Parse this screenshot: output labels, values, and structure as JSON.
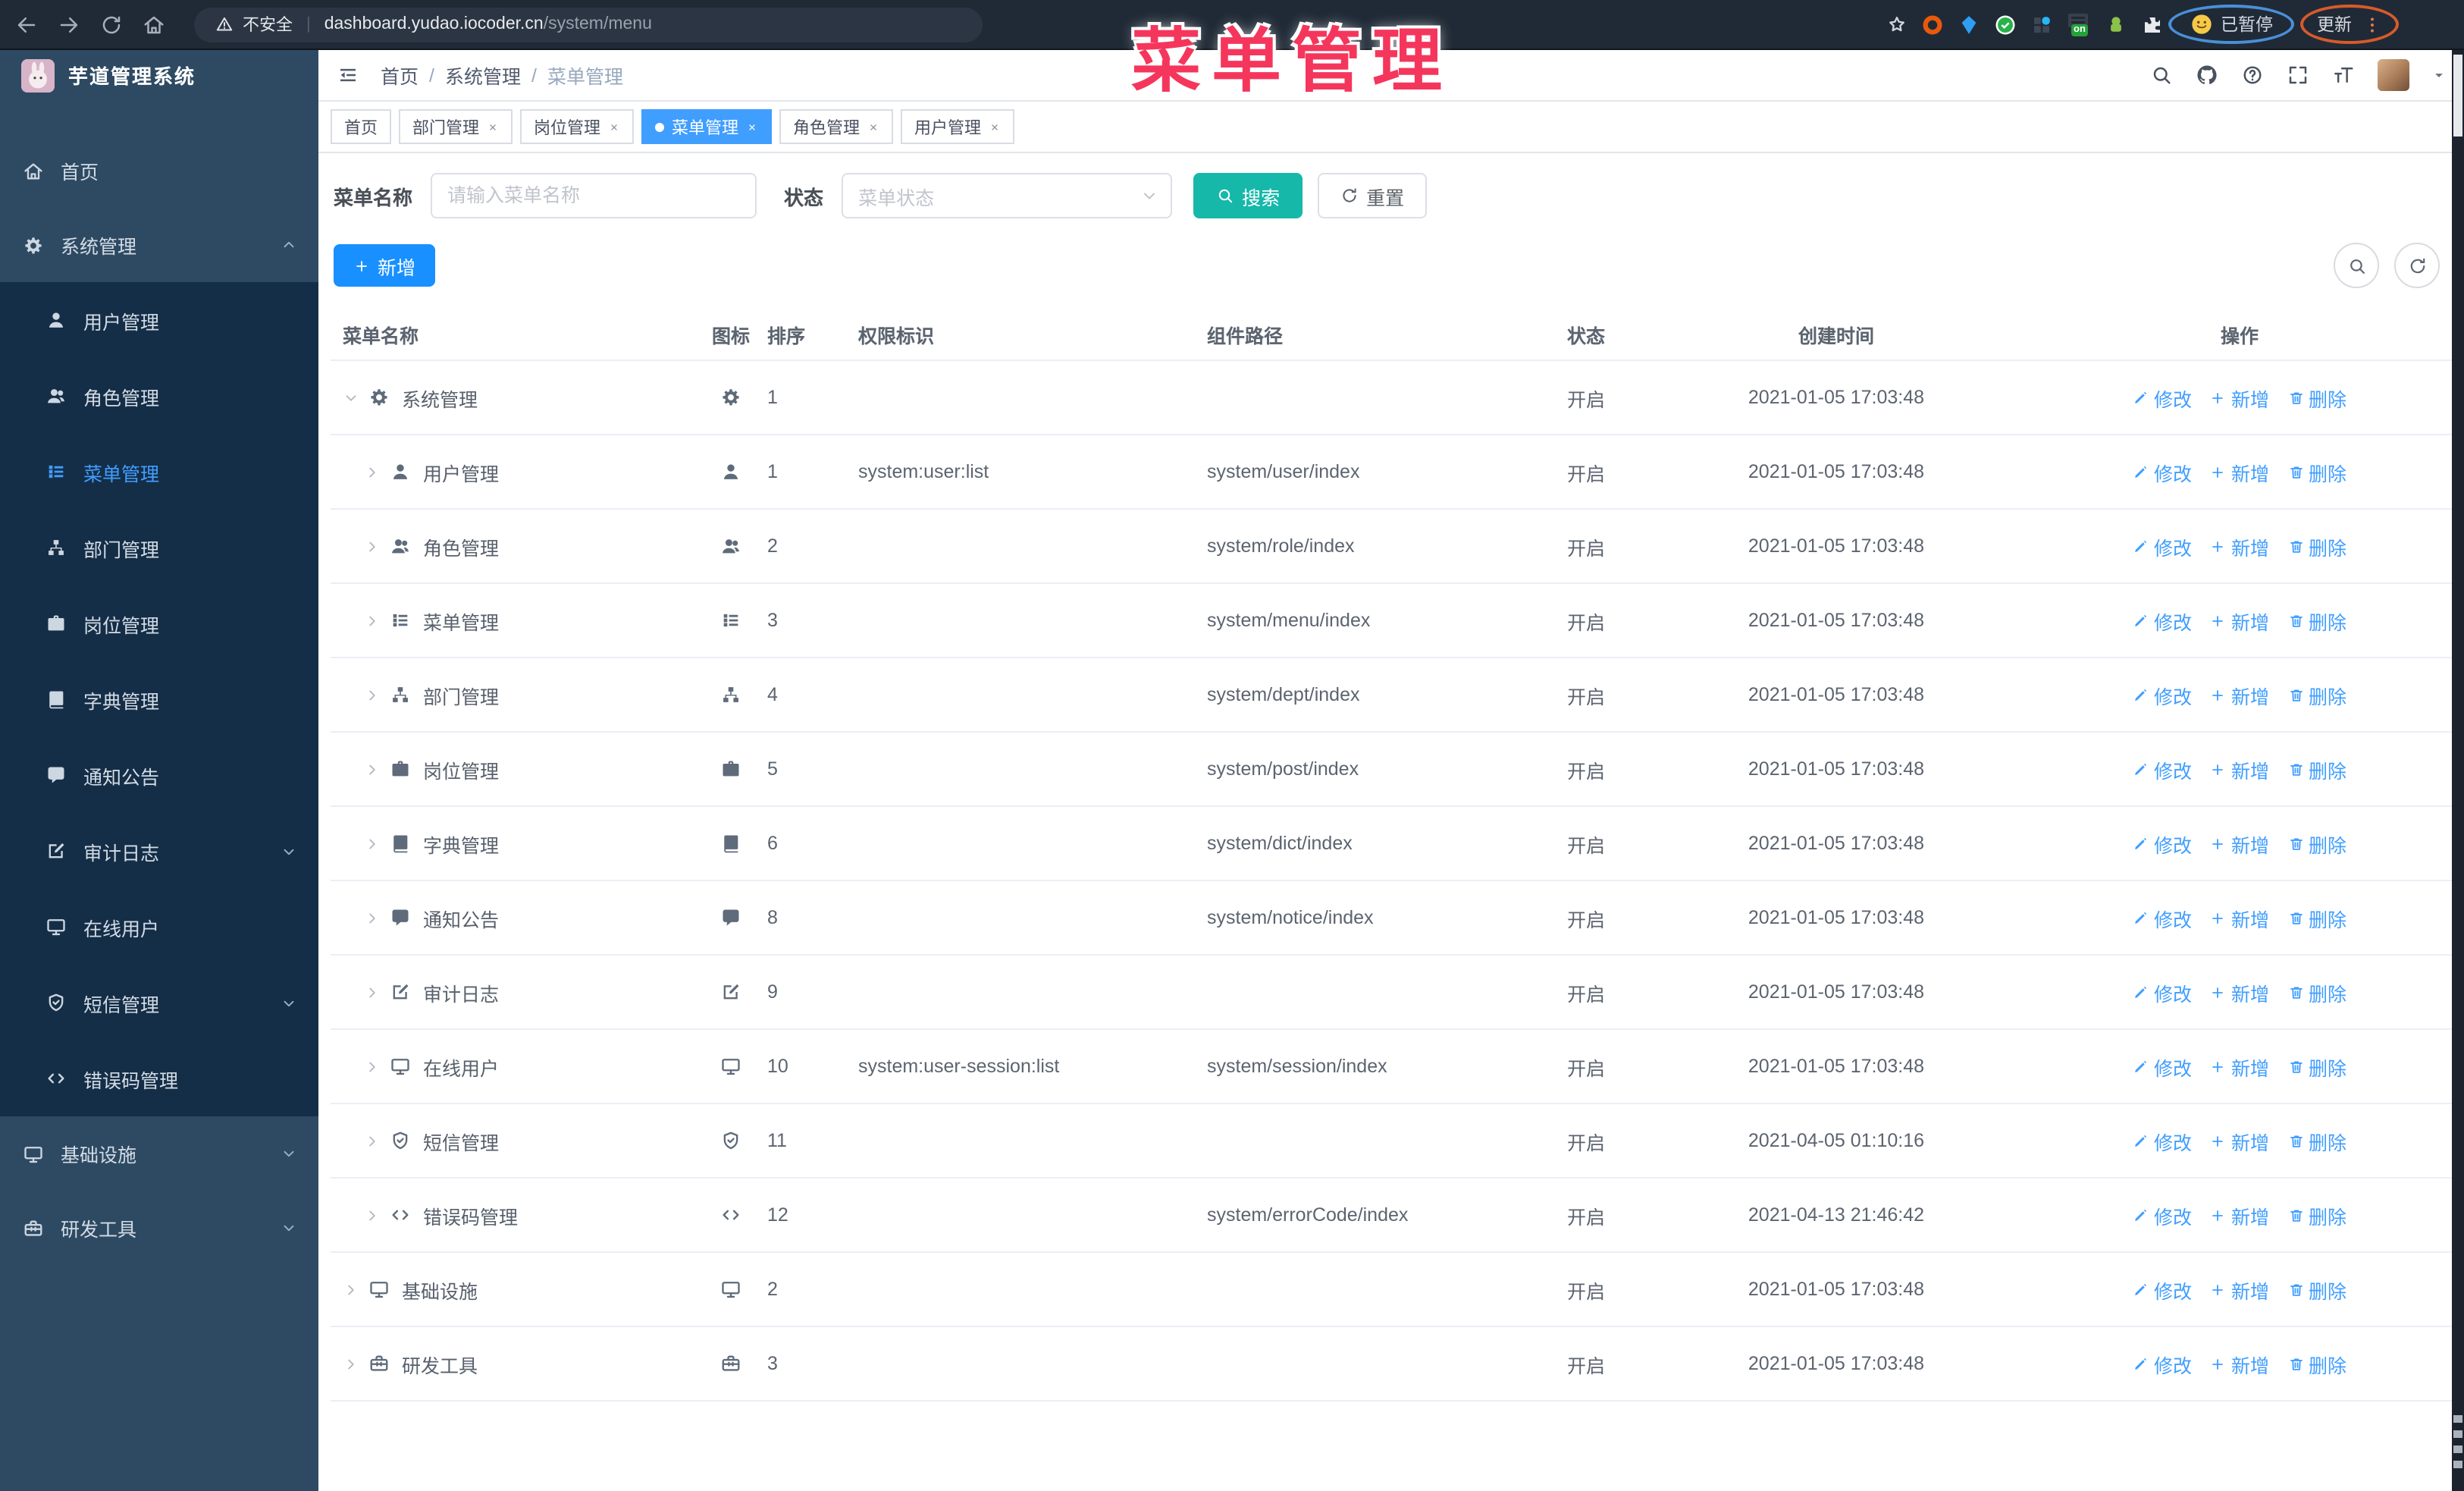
{
  "browser": {
    "security_label": "不安全",
    "url_host": "dashboard.yudao.iocoder.cn",
    "url_path": "/system/menu",
    "extensions": [
      {
        "name": "orange-ring"
      },
      {
        "name": "blue-gem"
      },
      {
        "name": "green-check"
      },
      {
        "name": "grid-blue-dot"
      },
      {
        "name": "on-badge",
        "label": "on"
      },
      {
        "name": "green-android"
      },
      {
        "name": "puzzle"
      }
    ],
    "profile_chip": {
      "label": "已暂停"
    },
    "update_label": "更新"
  },
  "annotation": {
    "text": "菜单管理",
    "color": "#f5365c"
  },
  "app": {
    "title": "芋道管理系统"
  },
  "breadcrumb": {
    "items": [
      "首页",
      "系统管理",
      "菜单管理"
    ]
  },
  "header_tabs": [
    {
      "label": "首页",
      "active": false,
      "closable": false
    },
    {
      "label": "部门管理",
      "active": false,
      "closable": true
    },
    {
      "label": "岗位管理",
      "active": false,
      "closable": true
    },
    {
      "label": "菜单管理",
      "active": true,
      "closable": true
    },
    {
      "label": "角色管理",
      "active": false,
      "closable": true
    },
    {
      "label": "用户管理",
      "active": false,
      "closable": true
    }
  ],
  "sidebar": {
    "items": [
      {
        "label": "首页",
        "icon": "home",
        "level": 0
      },
      {
        "label": "系统管理",
        "icon": "gear",
        "level": 0,
        "chevron": "up"
      },
      {
        "label": "用户管理",
        "icon": "user",
        "level": 1
      },
      {
        "label": "角色管理",
        "icon": "users",
        "level": 1
      },
      {
        "label": "菜单管理",
        "icon": "menu-list",
        "level": 1,
        "active": true
      },
      {
        "label": "部门管理",
        "icon": "org-tree",
        "level": 1
      },
      {
        "label": "岗位管理",
        "icon": "briefcase",
        "level": 1
      },
      {
        "label": "字典管理",
        "icon": "book",
        "level": 1
      },
      {
        "label": "通知公告",
        "icon": "message",
        "level": 1
      },
      {
        "label": "审计日志",
        "icon": "edit-square",
        "level": 1,
        "chevron": "down"
      },
      {
        "label": "在线用户",
        "icon": "monitor",
        "level": 1
      },
      {
        "label": "短信管理",
        "icon": "shield-check",
        "level": 1,
        "chevron": "down"
      },
      {
        "label": "错误码管理",
        "icon": "code",
        "level": 1
      },
      {
        "label": "基础设施",
        "icon": "monitor",
        "level": 0,
        "chevron": "down"
      },
      {
        "label": "研发工具",
        "icon": "toolbox",
        "level": 0,
        "chevron": "down"
      }
    ]
  },
  "filters": {
    "name_label": "菜单名称",
    "name_placeholder": "请输入菜单名称",
    "status_label": "状态",
    "status_placeholder": "菜单状态",
    "search_label": "搜索",
    "reset_label": "重置"
  },
  "toolbar": {
    "add_label": "新增"
  },
  "table": {
    "columns": [
      "菜单名称",
      "图标",
      "排序",
      "权限标识",
      "组件路径",
      "状态",
      "创建时间",
      "操作"
    ],
    "row_actions": [
      "修改",
      "新增",
      "删除"
    ],
    "rows": [
      {
        "name": "系统管理",
        "icon": "gear",
        "sort": "1",
        "perm": "",
        "path": "",
        "status": "开启",
        "time": "2021-01-05 17:03:48",
        "level": 0,
        "expanded": true
      },
      {
        "name": "用户管理",
        "icon": "user",
        "sort": "1",
        "perm": "system:user:list",
        "path": "system/user/index",
        "status": "开启",
        "time": "2021-01-05 17:03:48",
        "level": 1
      },
      {
        "name": "角色管理",
        "icon": "users",
        "sort": "2",
        "perm": "",
        "path": "system/role/index",
        "status": "开启",
        "time": "2021-01-05 17:03:48",
        "level": 1
      },
      {
        "name": "菜单管理",
        "icon": "menu-list",
        "sort": "3",
        "perm": "",
        "path": "system/menu/index",
        "status": "开启",
        "time": "2021-01-05 17:03:48",
        "level": 1
      },
      {
        "name": "部门管理",
        "icon": "org-tree",
        "sort": "4",
        "perm": "",
        "path": "system/dept/index",
        "status": "开启",
        "time": "2021-01-05 17:03:48",
        "level": 1
      },
      {
        "name": "岗位管理",
        "icon": "briefcase",
        "sort": "5",
        "perm": "",
        "path": "system/post/index",
        "status": "开启",
        "time": "2021-01-05 17:03:48",
        "level": 1
      },
      {
        "name": "字典管理",
        "icon": "book",
        "sort": "6",
        "perm": "",
        "path": "system/dict/index",
        "status": "开启",
        "time": "2021-01-05 17:03:48",
        "level": 1
      },
      {
        "name": "通知公告",
        "icon": "message",
        "sort": "8",
        "perm": "",
        "path": "system/notice/index",
        "status": "开启",
        "time": "2021-01-05 17:03:48",
        "level": 1
      },
      {
        "name": "审计日志",
        "icon": "edit-square",
        "sort": "9",
        "perm": "",
        "path": "",
        "status": "开启",
        "time": "2021-01-05 17:03:48",
        "level": 1
      },
      {
        "name": "在线用户",
        "icon": "monitor",
        "sort": "10",
        "perm": "system:user-session:list",
        "path": "system/session/index",
        "status": "开启",
        "time": "2021-01-05 17:03:48",
        "level": 1
      },
      {
        "name": "短信管理",
        "icon": "shield-check",
        "sort": "11",
        "perm": "",
        "path": "",
        "status": "开启",
        "time": "2021-04-05 01:10:16",
        "level": 1
      },
      {
        "name": "错误码管理",
        "icon": "code",
        "sort": "12",
        "perm": "",
        "path": "system/errorCode/index",
        "status": "开启",
        "time": "2021-04-13 21:46:42",
        "level": 1
      },
      {
        "name": "基础设施",
        "icon": "monitor",
        "sort": "2",
        "perm": "",
        "path": "",
        "status": "开启",
        "time": "2021-01-05 17:03:48",
        "level": 0
      },
      {
        "name": "研发工具",
        "icon": "toolbox",
        "sort": "3",
        "perm": "",
        "path": "",
        "status": "开启",
        "time": "2021-01-05 17:03:48",
        "level": 0
      }
    ]
  },
  "colors": {
    "accent_blue": "#409eff",
    "add_button_blue": "#1890ff",
    "search_teal": "#16b8aa",
    "annotation_red": "#f5365c",
    "sidebar_bg": "#2e4a63",
    "sidebar_submenu_bg": "#152e47"
  }
}
